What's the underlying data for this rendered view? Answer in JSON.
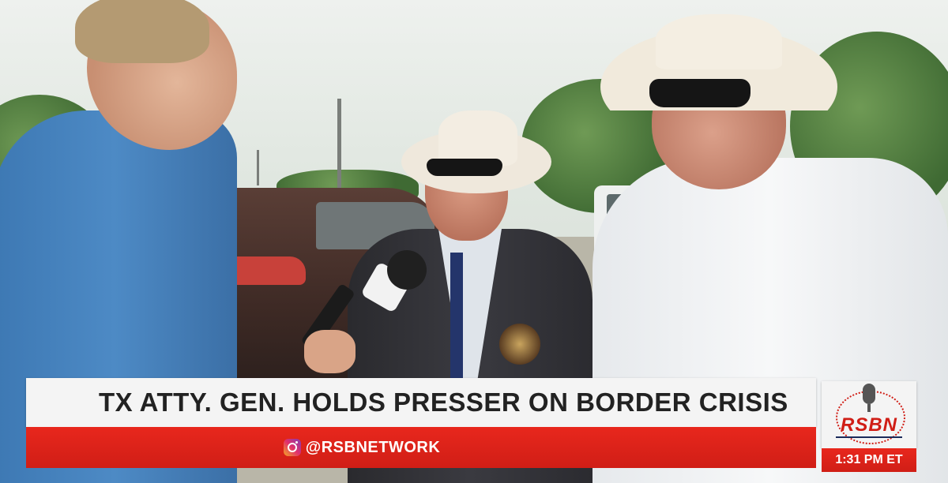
{
  "broadcast": {
    "headline": "TX ATTY. GEN. HOLDS PRESSER ON BORDER CRISIS",
    "social_handle": "@RSBNETWORK",
    "social_icon": "instagram-icon",
    "logo_text": "RSBN",
    "timestamp": "1:31 PM ET"
  },
  "colors": {
    "accent_red": "#d01e16",
    "bar_white": "#f4f4f4",
    "logo_navy": "#1b2a5a"
  }
}
